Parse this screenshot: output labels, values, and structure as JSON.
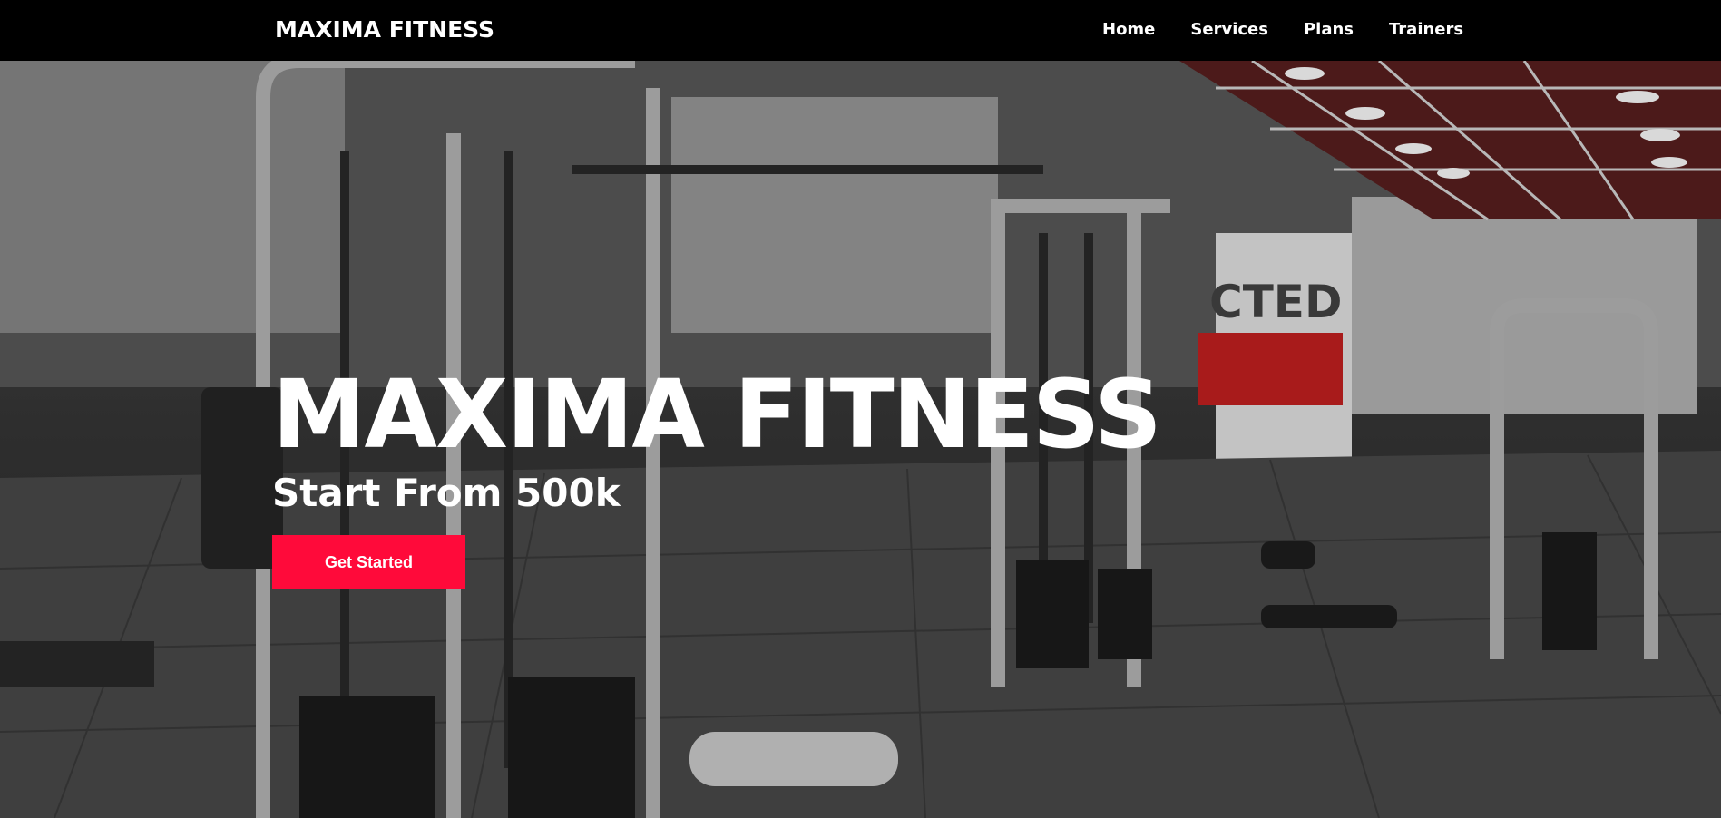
{
  "navbar": {
    "brand": "MAXIMA FITNESS",
    "links": [
      "Home",
      "Services",
      "Plans",
      "Trainers"
    ]
  },
  "hero": {
    "title": "MAXIMA FITNESS",
    "subtitle": "Start From 500k",
    "cta_label": "Get Started",
    "background_image": "gym-interior-photo",
    "wall_sign_text": "CTED"
  },
  "colors": {
    "navbar_bg": "#000000",
    "accent": "#ff0a3a",
    "text": "#ffffff"
  }
}
